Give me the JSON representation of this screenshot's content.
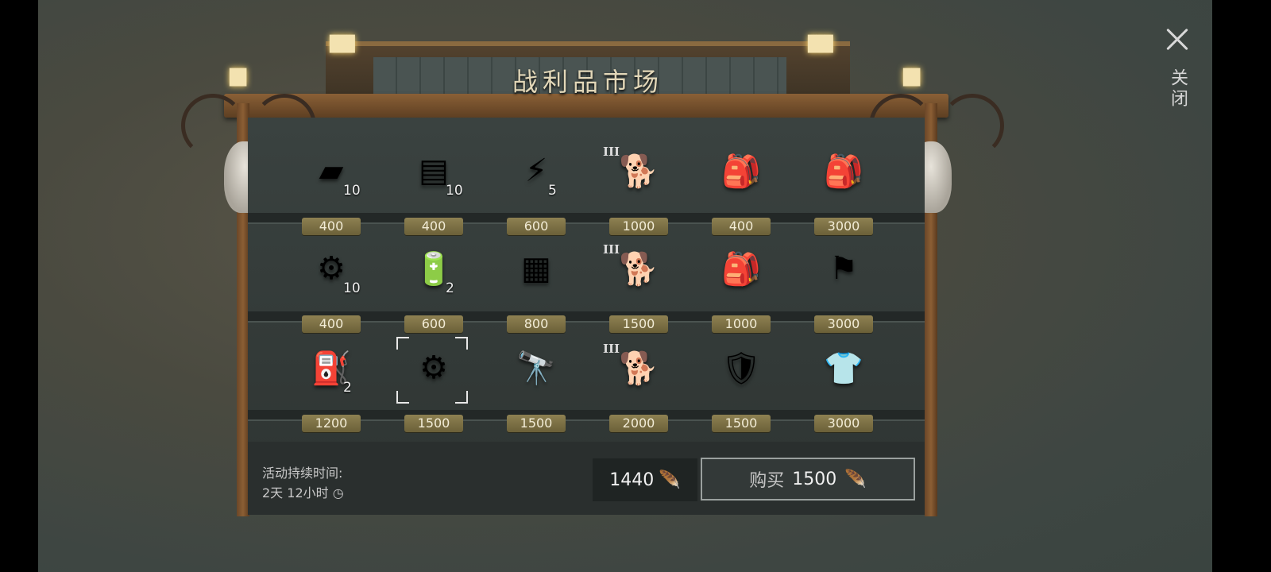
{
  "market": {
    "title": "战利品市场",
    "close_label": "关闭"
  },
  "items": [
    {
      "name": "leather",
      "icon": "leather-icon",
      "glyph": "▰",
      "count": "10",
      "price": "400",
      "tier": ""
    },
    {
      "name": "cloth",
      "icon": "cloth-icon",
      "glyph": "▤",
      "count": "10",
      "price": "400",
      "tier": ""
    },
    {
      "name": "electronic-parts",
      "icon": "electronic-parts-icon",
      "glyph": "⚡",
      "count": "5",
      "price": "600",
      "tier": ""
    },
    {
      "name": "puppy-shepherd",
      "icon": "puppy-icon",
      "glyph": "🐕",
      "count": "",
      "price": "1000",
      "tier": "III"
    },
    {
      "name": "military-backpack",
      "icon": "backpack-icon",
      "glyph": "🎒",
      "count": "",
      "price": "400",
      "tier": ""
    },
    {
      "name": "biker-backpack",
      "icon": "skull-backpack-icon",
      "glyph": "🎒",
      "count": "",
      "price": "3000",
      "tier": ""
    },
    {
      "name": "engine-cylinder",
      "icon": "cylinder-icon",
      "glyph": "⚙",
      "count": "10",
      "price": "400",
      "tier": ""
    },
    {
      "name": "battery",
      "icon": "battery-icon",
      "glyph": "🔋",
      "count": "2",
      "price": "600",
      "tier": ""
    },
    {
      "name": "circuit-board",
      "icon": "circuit-board-icon",
      "glyph": "▦",
      "count": "",
      "price": "800",
      "tier": ""
    },
    {
      "name": "puppy-husky",
      "icon": "husky-puppy-icon",
      "glyph": "🐕",
      "count": "",
      "price": "1500",
      "tier": "III"
    },
    {
      "name": "tactical-backpack",
      "icon": "black-backpack-icon",
      "glyph": "🎒",
      "count": "",
      "price": "1000",
      "tier": ""
    },
    {
      "name": "cernunnos-flag",
      "icon": "flag-icon",
      "glyph": "⚑",
      "count": "",
      "price": "3000",
      "tier": ""
    },
    {
      "name": "gas-cylinder",
      "icon": "gas-cylinder-icon",
      "glyph": "⛽",
      "count": "2",
      "price": "1200",
      "tier": ""
    },
    {
      "name": "shock-absorber",
      "icon": "shock-absorber-icon",
      "glyph": "⚙",
      "count": "",
      "price": "1500",
      "tier": ""
    },
    {
      "name": "scope-strap",
      "icon": "scope-icon",
      "glyph": "🔭",
      "count": "",
      "price": "1500",
      "tier": ""
    },
    {
      "name": "puppy-rottweiler",
      "icon": "rottweiler-puppy-icon",
      "glyph": "🐕",
      "count": "",
      "price": "2000",
      "tier": "III"
    },
    {
      "name": "police-badge",
      "icon": "badge-wallet-icon",
      "glyph": "🛡",
      "count": "",
      "price": "1500",
      "tier": ""
    },
    {
      "name": "biker-outfit",
      "icon": "outfit-icon",
      "glyph": "👕",
      "count": "",
      "price": "3000",
      "tier": ""
    }
  ],
  "footer": {
    "duration_label": "活动持续时间:",
    "duration_value": "2天 12小时",
    "balance": "1440",
    "buy_label": "购买",
    "buy_price": "1500",
    "currency_icon": "feather-icon"
  },
  "colors": {
    "price_tag": "#8e8152",
    "panel": "#343b39",
    "beam": "#7a5530"
  }
}
